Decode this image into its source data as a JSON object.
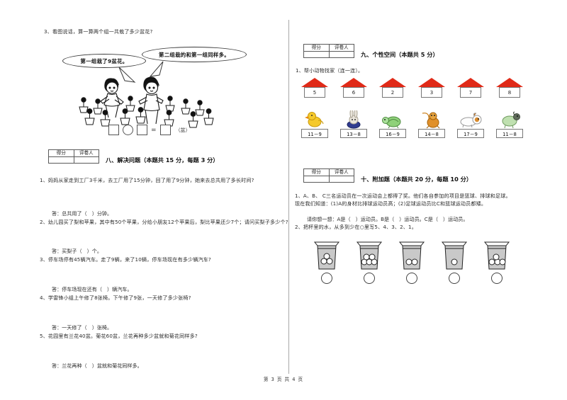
{
  "document": {
    "footer": "第 3 页  共 4 页"
  },
  "score_box": {
    "score_label": "得分",
    "grader_label": "评卷人"
  },
  "left_column": {
    "picture_question": {
      "number_text": "3、看图说话，算一算两个组一共栽了多少盆花?",
      "bubble_left": "第一组栽了9盆花。",
      "bubble_right": "第二组栽的和第一组同样多。",
      "equation_operator": "=",
      "equation_unit": "（盆）"
    },
    "section_eight": {
      "title": "八、解决问题（本题共 15 分，每题 3 分）",
      "questions": [
        {
          "text": "1、妈妈从家走到工厂3千米，去工厂用了15分钟，回了用了9分钟，她来去总共用了多长时间?",
          "answer": "答：总共用了（　）分钟。"
        },
        {
          "text": "2、幼儿园买了梨和苹果，其中有50个苹果，分给小朋友12个苹果后，梨比苹果还少7个；请问买梨子多少个?",
          "answer": "答：买梨子（　）个。"
        },
        {
          "text": "3、停车场停有45辆汽车。走了9辆，来了10辆，停车场现在有多少辆汽车?",
          "answer": "答：停车场现在还有（　）辆汽车。"
        },
        {
          "text": "4、学雷锋小组上午修了8张椅。下午修了9张，一天修了多少张椅?",
          "answer": "答：一天修了（　）张椅。"
        },
        {
          "text": "5、花园里有兰花40盆。菊花60盆，兰花再种多少盆就和菊花同样多?",
          "answer": "答：兰花再种（　）盆就和菊花同样多。"
        }
      ]
    }
  },
  "right_column": {
    "section_nine": {
      "title": "九、个性空间（本题共 5 分）",
      "question": "1、帮小动物找家（连一连）。",
      "houses": [
        {
          "number": "5"
        },
        {
          "number": "6"
        },
        {
          "number": "2"
        },
        {
          "number": "3"
        },
        {
          "number": "7"
        },
        {
          "number": "8"
        }
      ],
      "animals": [
        {
          "icon": "duck-icon",
          "equation": "11－9"
        },
        {
          "icon": "rabbit-icon",
          "equation": "13－8"
        },
        {
          "icon": "turtle-icon",
          "equation": "16－9"
        },
        {
          "icon": "monkey-icon",
          "equation": "14－8"
        },
        {
          "icon": "dog-icon",
          "equation": "17－9"
        },
        {
          "icon": "sheep-icon",
          "equation": "11－8"
        }
      ]
    },
    "section_ten": {
      "title": "十、附加题（本题共 20 分，每题 10 分）",
      "question1_line1": "1、A、B、 C三名运动员在一次运动会上都得了奖。他们各自参加的项目是篮球、排球和足球。",
      "question1_line2": "现在我们知道：(1)A的身材比排球运动员高；(2)足球运动员比C和篮球运动员都矮。",
      "question1_line3": "请你想一想：A是（　）运动员。B是（　）运动员。C是（　）运动员。",
      "question2": "2、把杯里的水，从多到少在○里写5、4、3、2、1。",
      "cups": [
        {
          "balls": 3
        },
        {
          "balls": 5
        },
        {
          "balls": 2
        },
        {
          "balls": 1
        },
        {
          "balls": 4
        }
      ]
    }
  },
  "colors": {
    "roof_red": "#e02a18",
    "water_gray": "#c9c9c9",
    "line_gray": "#5a5a5a"
  }
}
